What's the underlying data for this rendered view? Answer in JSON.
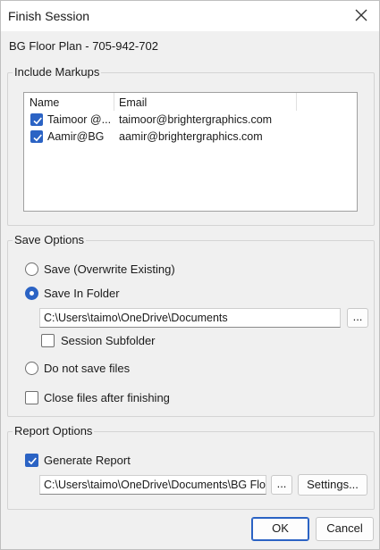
{
  "window": {
    "title": "Finish Session"
  },
  "document_title": "BG Floor Plan - 705-942-702",
  "markups": {
    "group_label": "Include Markups",
    "columns": [
      "Name",
      "Email"
    ],
    "rows": [
      {
        "name": "Taimoor @...",
        "email": "taimoor@brightergraphics.com",
        "checked": true
      },
      {
        "name": "Aamir@BG",
        "email": "aamir@brightergraphics.com",
        "checked": true
      }
    ]
  },
  "save_options": {
    "group_label": "Save Options",
    "overwrite_label": "Save (Overwrite Existing)",
    "in_folder_label": "Save In Folder",
    "selected": "Save In Folder",
    "folder_path": "C:\\Users\\taimo\\OneDrive\\Documents",
    "browse_label": "...",
    "subfolder_label": "Session Subfolder",
    "subfolder_checked": false,
    "no_save_label": "Do not save files",
    "close_files_label": "Close files after finishing",
    "close_files_checked": false
  },
  "report_options": {
    "group_label": "Report Options",
    "generate_label": "Generate Report",
    "generate_checked": true,
    "report_path": "C:\\Users\\taimo\\OneDrive\\Documents\\BG Flo",
    "browse_label": "...",
    "settings_label": "Settings..."
  },
  "footer": {
    "ok_label": "OK",
    "cancel_label": "Cancel"
  },
  "colors": {
    "accent": "#2b63c4",
    "dialog_bg": "#f0f0f0"
  }
}
